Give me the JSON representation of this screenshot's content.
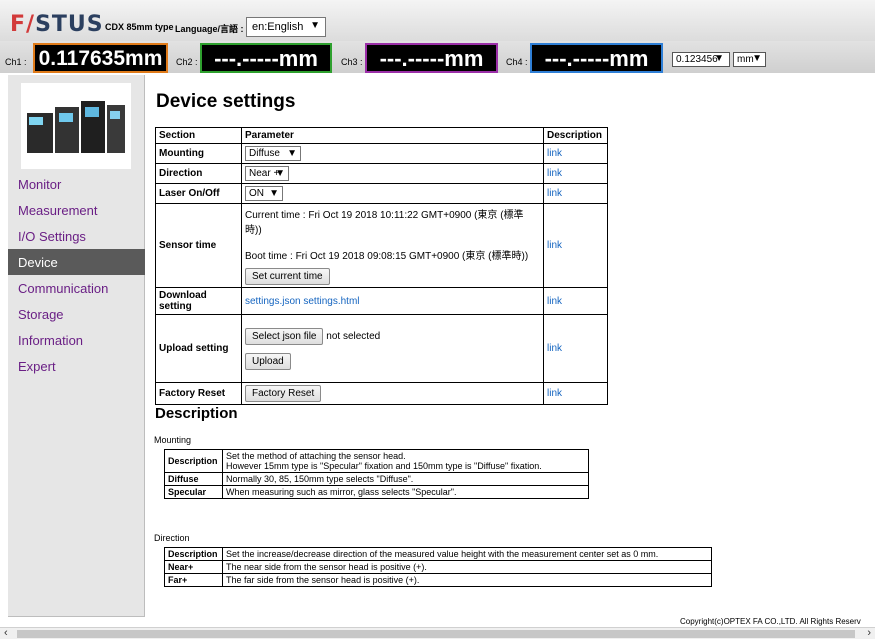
{
  "header": {
    "logo": "FASTUS",
    "model": "CDX 85mm type",
    "language_label": "Language/言語 :",
    "language_value": "en:English"
  },
  "channels": [
    {
      "label": "Ch1 :",
      "value": "0.117635mm",
      "color": "#e07b1a"
    },
    {
      "label": "Ch2 :",
      "value": "---.-----mm",
      "color": "#2ea02e"
    },
    {
      "label": "Ch3 :",
      "value": "---.-----mm",
      "color": "#9b2fa8"
    },
    {
      "label": "Ch4 :",
      "value": "---.-----mm",
      "color": "#2f7fd6"
    }
  ],
  "precision_value": "0.123456",
  "unit_value": "mm",
  "nav": [
    "Monitor",
    "Measurement",
    "I/O Settings",
    "Device",
    "Communication",
    "Storage",
    "Information",
    "Expert"
  ],
  "active_nav": "Device",
  "page_title": "Device settings",
  "settings_table": {
    "headers": [
      "Section",
      "Parameter",
      "Description"
    ],
    "link_label": "link",
    "mounting": {
      "label": "Mounting",
      "value": "Diffuse"
    },
    "direction": {
      "label": "Direction",
      "value": "Near +"
    },
    "laser": {
      "label": "Laser On/Off",
      "value": "ON"
    },
    "sensor_time": {
      "label": "Sensor time",
      "current": "Current time : Fri Oct 19 2018 10:11:22 GMT+0900 (東京 (標準時))",
      "boot": "Boot time : Fri Oct 19 2018 09:08:15 GMT+0900 (東京 (標準時))",
      "button": "Set current time"
    },
    "download": {
      "label": "Download setting",
      "json": "settings.json",
      "html": "settings.html"
    },
    "upload": {
      "label": "Upload setting",
      "file_button": "Select json file",
      "file_status": "not selected",
      "button": "Upload"
    },
    "factory": {
      "label": "Factory Reset",
      "button": "Factory Reset"
    }
  },
  "description": {
    "title": "Description",
    "mounting": {
      "title": "Mounting",
      "rows": [
        {
          "k": "Description",
          "v1": "Set the method of attaching the sensor head.",
          "v2": "However 15mm type is \"Specular\" fixation  and 150mm type is \"Diffuse\" fixation."
        },
        {
          "k": "Diffuse",
          "v1": "Normally 30, 85, 150mm type selects \"Diffuse\"."
        },
        {
          "k": "Specular",
          "v1": "When measuring such as mirror, glass selects \"Specular\"."
        }
      ]
    },
    "direction": {
      "title": "Direction",
      "rows": [
        {
          "k": "Description",
          "v1": "Set the increase/decrease direction of the measured value height with the measurement center set as 0 mm."
        },
        {
          "k": "Near+",
          "v1": "The near side from the sensor head is positive (+)."
        },
        {
          "k": "Far+",
          "v1": "The far side from the sensor head is positive (+)."
        }
      ]
    }
  },
  "footer": "Copyright(c)OPTEX FA CO.,LTD. All Rights Reserv"
}
